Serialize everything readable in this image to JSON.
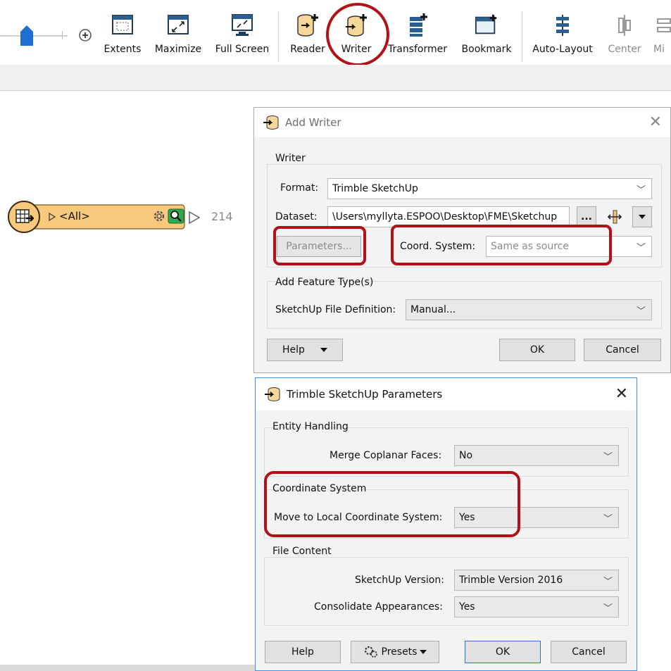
{
  "toolbar": {
    "items": [
      {
        "label": "Extents",
        "icon": "extents-icon",
        "dim": false
      },
      {
        "label": "Maximize",
        "icon": "maximize-icon",
        "dim": false
      },
      {
        "label": "Full Screen",
        "icon": "full-screen-icon",
        "dim": false
      },
      {
        "label": "Reader",
        "icon": "reader-icon",
        "dim": false
      },
      {
        "label": "Writer",
        "icon": "writer-icon",
        "dim": false
      },
      {
        "label": "Transformer",
        "icon": "transformer-icon",
        "dim": false
      },
      {
        "label": "Bookmark",
        "icon": "bookmark-icon",
        "dim": false
      },
      {
        "label": "Auto-Layout",
        "icon": "auto-layout-icon",
        "dim": false
      },
      {
        "label": "Center",
        "icon": "center-icon",
        "dim": true
      },
      {
        "label": "Mi",
        "icon": "middle-icon",
        "dim": true
      }
    ]
  },
  "canvas": {
    "node_label": "<All>",
    "feature_count": "214"
  },
  "add_writer": {
    "title": "Add Writer",
    "writer_group": "Writer",
    "format_label": "Format:",
    "format_value": "Trimble SketchUp",
    "dataset_label": "Dataset:",
    "dataset_value": "\\Users\\myllyta.ESPOO\\Desktop\\FME\\Sketchup",
    "browse_label": "...",
    "parameters_label": "Parameters...",
    "coord_label": "Coord. System:",
    "coord_placeholder": "Same as source",
    "feature_group": "Add Feature Type(s)",
    "definition_label": "SketchUp File Definition:",
    "definition_value": "Manual...",
    "help_label": "Help",
    "ok_label": "OK",
    "cancel_label": "Cancel"
  },
  "params": {
    "title": "Trimble SketchUp Parameters",
    "entity_group": "Entity Handling",
    "merge_label": "Merge Coplanar Faces:",
    "merge_value": "No",
    "coord_group": "Coordinate System",
    "local_label": "Move to Local Coordinate System:",
    "local_value": "Yes",
    "file_group": "File Content",
    "version_label": "SketchUp Version:",
    "version_value": "Trimble Version 2016",
    "consolidate_label": "Consolidate Appearances:",
    "consolidate_value": "Yes",
    "help_label": "Help",
    "presets_label": "Presets",
    "ok_label": "OK",
    "cancel_label": "Cancel"
  },
  "colors": {
    "highlight_red": "#b01217",
    "node_fill": "#f7c97c",
    "ok_border": "#2a6fd6"
  }
}
